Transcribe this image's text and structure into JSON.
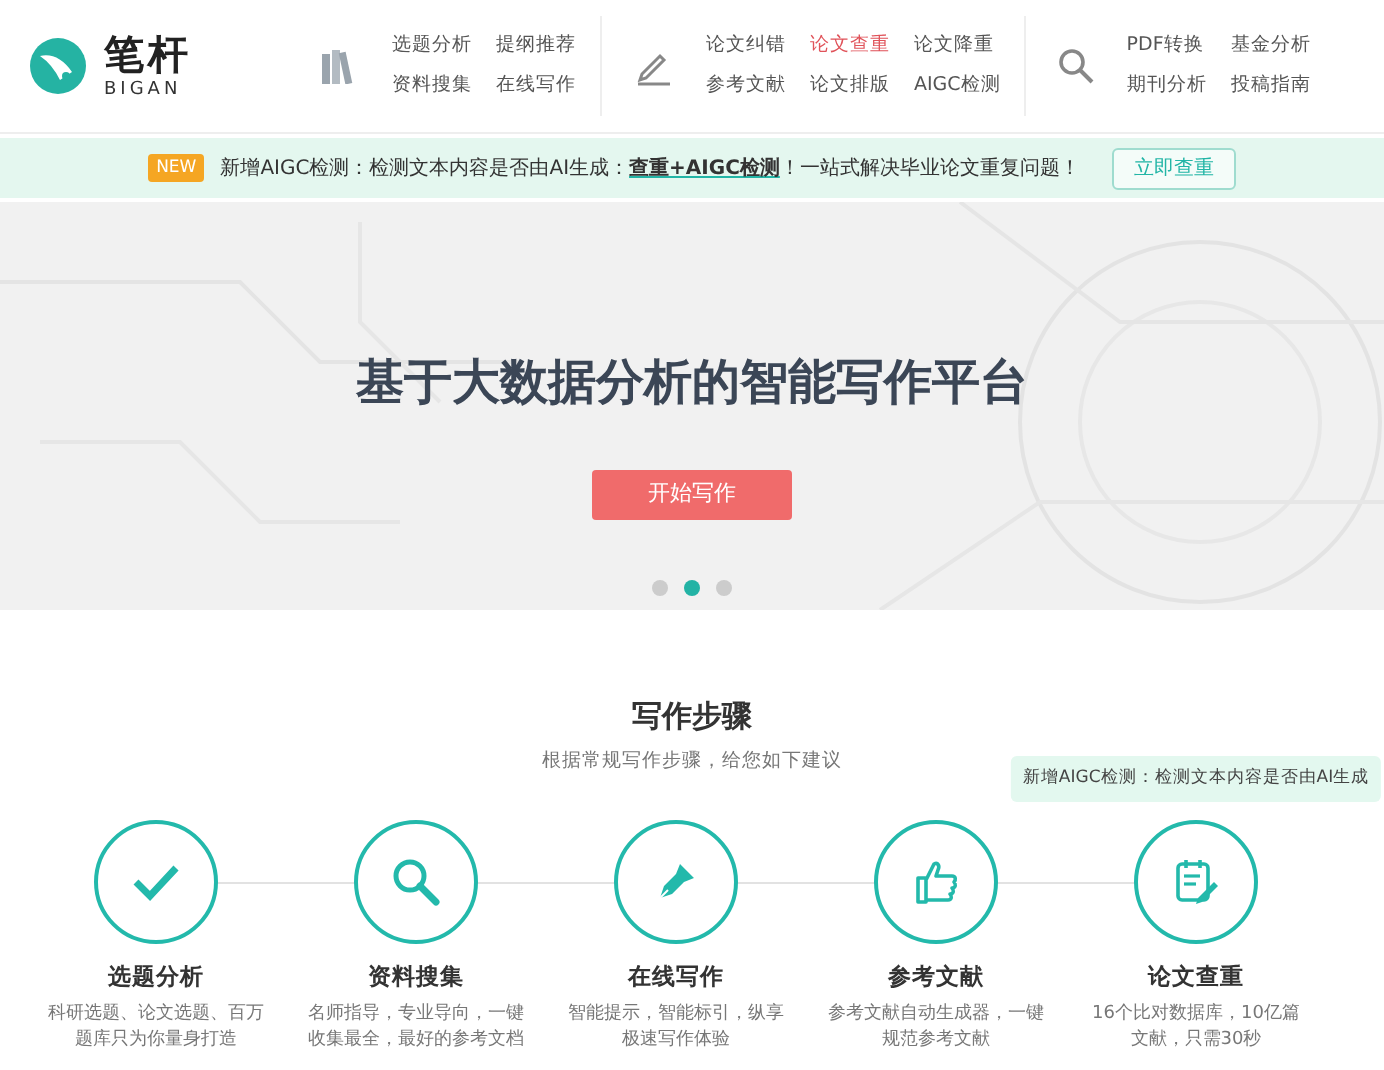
{
  "header": {
    "logo": {
      "name": "笔杆",
      "sub": "BIGAN"
    },
    "nav_groups": [
      {
        "links": [
          {
            "label": "选题分析",
            "selected": false
          },
          {
            "label": "提纲推荐",
            "selected": false
          },
          {
            "label": "资料搜集",
            "selected": false
          },
          {
            "label": "在线写作",
            "selected": false
          }
        ]
      },
      {
        "links": [
          {
            "label": "论文纠错",
            "selected": false
          },
          {
            "label": "论文查重",
            "selected": true
          },
          {
            "label": "论文降重",
            "selected": false
          },
          {
            "label": "参考文献",
            "selected": false
          },
          {
            "label": "论文排版",
            "selected": false
          },
          {
            "label": "AIGC检测",
            "selected": false
          }
        ]
      },
      {
        "links": [
          {
            "label": "PDF转换",
            "selected": false
          },
          {
            "label": "基金分析",
            "selected": false
          },
          {
            "label": "期刊分析",
            "selected": false
          },
          {
            "label": "投稿指南",
            "selected": false
          }
        ]
      }
    ]
  },
  "announcement": {
    "badge": "NEW",
    "text_before": "新增AIGC检测：检测文本内容是否由AI生成：",
    "link": "查重+AIGC检测",
    "text_after": "！一站式解决毕业论文重复问题！",
    "button": "立即查重"
  },
  "hero": {
    "title": "基于大数据分析的智能写作平台",
    "button": "开始写作",
    "dots": [
      {
        "selected": false
      },
      {
        "selected": true
      },
      {
        "selected": false
      }
    ]
  },
  "steps_section": {
    "title": "写作步骤",
    "subtitle": "根据常规写作步骤，给您如下建议",
    "tooltip": "新增AIGC检测：检测文本内容是否由AI生成",
    "steps": [
      {
        "title": "选题分析",
        "lines": [
          "科研选题、论文选题、百万",
          "题库只为你量身打造"
        ]
      },
      {
        "title": "资料搜集",
        "lines": [
          "名师指导，专业导向，一键",
          "收集最全，最好的参考文档"
        ]
      },
      {
        "title": "在线写作",
        "lines": [
          "智能提示，智能标引，纵享",
          "极速写作体验"
        ]
      },
      {
        "title": "参考文献",
        "lines": [
          "参考文献自动生成器，一键",
          "规范参考文献"
        ]
      },
      {
        "title": "论文查重",
        "lines": [
          "16个比对数据库，10亿篇",
          "文献，只需30秒"
        ]
      }
    ]
  }
}
